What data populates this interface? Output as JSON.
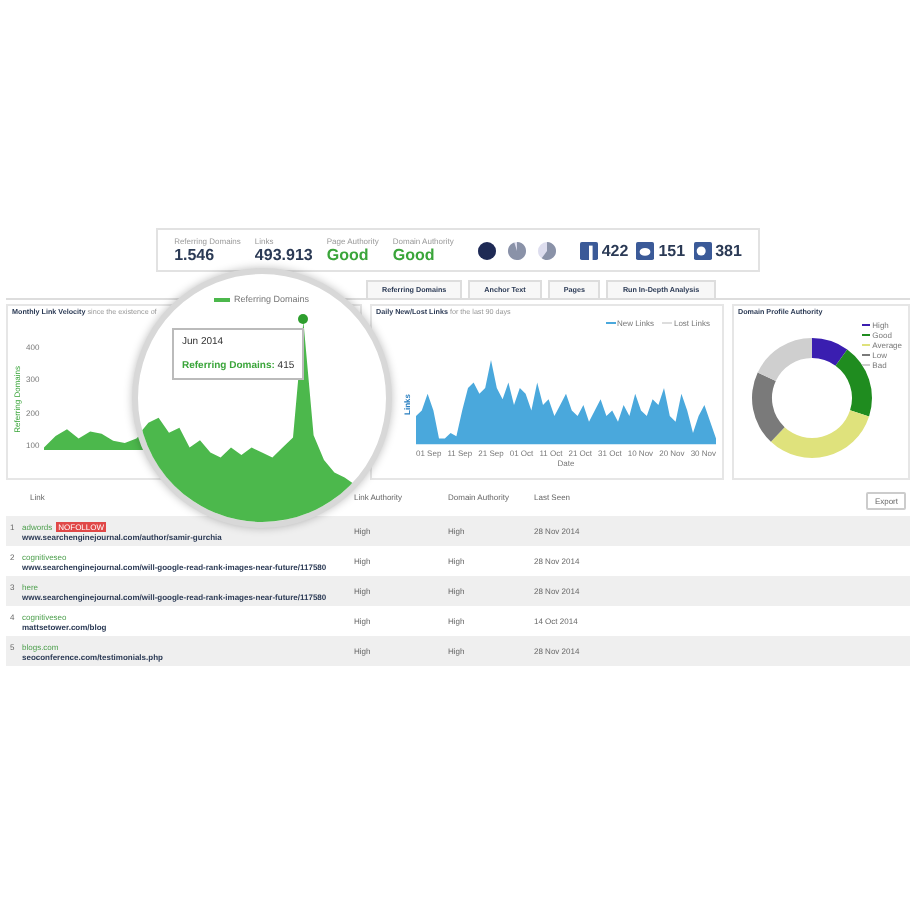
{
  "stats": [
    {
      "label": "Referring Domains",
      "value": "1.546",
      "kind": "number"
    },
    {
      "label": "Links",
      "value": "493.913",
      "kind": "number"
    },
    {
      "label": "Page Authority",
      "value": "Good",
      "kind": "rating"
    },
    {
      "label": "Domain Authority",
      "value": "Good",
      "kind": "rating"
    }
  ],
  "social": [
    {
      "kind": "facebook",
      "count": "422"
    },
    {
      "kind": "twitter",
      "count": "151"
    },
    {
      "kind": "googleplus",
      "count": "381"
    }
  ],
  "tabs": [
    {
      "label": "Referring Domains",
      "selected": false
    },
    {
      "label": "Anchor Text",
      "selected": false
    },
    {
      "label": "Pages",
      "selected": false
    },
    {
      "label": "Run In-Depth Analysis",
      "selected": false
    }
  ],
  "lens": {
    "legend": "Referring Domains",
    "tooltip_title": "Jun 2014",
    "tooltip_label": "Referring Domains:",
    "tooltip_value": "415"
  },
  "velocity_chart": {
    "title": "Monthly Link Velocity",
    "subtitle": "since the existence of",
    "y_label": "Referring Domains",
    "y_ticks": [
      "400",
      "300",
      "200",
      "100"
    ]
  },
  "links_chart": {
    "title": "Daily New/Lost Links",
    "subtitle": "for the last 90 days",
    "legend": [
      {
        "label": "New Links",
        "color": "#4aa8dc"
      },
      {
        "label": "Lost Links",
        "color": "#dddddd"
      }
    ],
    "y_label": "Links",
    "x_label": "Date",
    "x_ticks": [
      "01 Sep",
      "11 Sep",
      "21 Sep",
      "01 Oct",
      "11 Oct",
      "21 Oct",
      "31 Oct",
      "10 Nov",
      "20 Nov",
      "30 Nov"
    ]
  },
  "authority_chart": {
    "title": "Domain Profile Authority",
    "legend": [
      {
        "label": "High",
        "color": "#3a1eb0"
      },
      {
        "label": "Good",
        "color": "#1f8c1f"
      },
      {
        "label": "Average",
        "color": "#dfe27c"
      },
      {
        "label": "Low",
        "color": "#7a7a7a"
      },
      {
        "label": "Bad",
        "color": "#cfcfcf"
      }
    ]
  },
  "table": {
    "export": "Export",
    "columns": [
      "Link",
      "Link Authority",
      "Domain Authority",
      "Last Seen"
    ],
    "rows": [
      {
        "index": "1",
        "anchor": "adwords",
        "badge": "NOFOLLOW",
        "url": "www.searchenginejournal.com/author/samir-gurchia",
        "link_authority": "High",
        "domain_authority": "High",
        "last_seen": "28 Nov 2014"
      },
      {
        "index": "2",
        "anchor": "cognitiveseo",
        "url": "www.searchenginejournal.com/will-google-read-rank-images-near-future/117580",
        "link_authority": "High",
        "domain_authority": "High",
        "last_seen": "28 Nov 2014"
      },
      {
        "index": "3",
        "anchor": "here",
        "url": "www.searchenginejournal.com/will-google-read-rank-images-near-future/117580",
        "link_authority": "High",
        "domain_authority": "High",
        "last_seen": "28 Nov 2014"
      },
      {
        "index": "4",
        "anchor": "cognitiveseo",
        "url": "mattsetower.com/blog",
        "link_authority": "High",
        "domain_authority": "High",
        "last_seen": "14 Oct 2014"
      },
      {
        "index": "5",
        "anchor": "blogs.com",
        "url": "seoconference.com/testimonials.php",
        "link_authority": "High",
        "domain_authority": "High",
        "last_seen": "28 Nov 2014"
      }
    ]
  }
}
